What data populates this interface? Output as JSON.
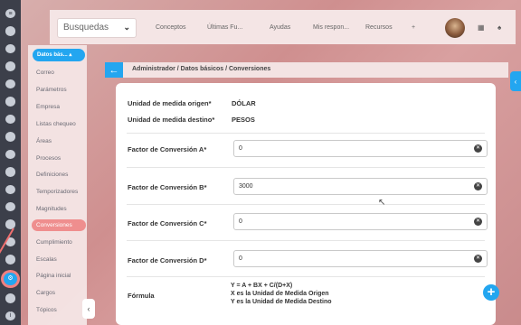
{
  "topbar": {
    "search_label": "Busquedas",
    "links": [
      "Conceptos",
      "Últimas Fu...",
      "Ayudas",
      "Mis respon...",
      "Recursos"
    ]
  },
  "sidebar": {
    "header": "Datos bás...",
    "items": [
      {
        "label": "Correo"
      },
      {
        "label": "Parámetros"
      },
      {
        "label": "Empresa"
      },
      {
        "label": "Listas chequeo"
      },
      {
        "label": "Áreas"
      },
      {
        "label": "Procesos"
      },
      {
        "label": "Definiciones"
      },
      {
        "label": "Temporizadores"
      },
      {
        "label": "Magnitudes"
      },
      {
        "label": "Conversiones",
        "highlighted": true
      },
      {
        "label": "Cumplimiento"
      },
      {
        "label": "Escalas"
      },
      {
        "label": "Página inicial"
      },
      {
        "label": "Cargos"
      },
      {
        "label": "Tópicos"
      }
    ]
  },
  "breadcrumb": "Administrador / Datos básicos / Conversiones",
  "form": {
    "origin_label": "Unidad de medida origen*",
    "origin_value": "DÓLAR",
    "dest_label": "Unidad de medida destino*",
    "dest_value": "PESOS",
    "factor_a_label": "Factor de Conversión A*",
    "factor_a_value": "0",
    "factor_b_label": "Factor de Conversión B*",
    "factor_b_value": "3000",
    "factor_c_label": "Factor de Conversión C*",
    "factor_c_value": "0",
    "factor_d_label": "Factor de Conversión D*",
    "factor_d_value": "0",
    "formula_label": "Fórmula",
    "formula_line1": "Y = A + BX + C/(D+X)",
    "formula_line2": "X es la Unidad de Medida Origen",
    "formula_line3": "Y es la Unidad de Medida Destino"
  },
  "colors": {
    "accent": "#23a6f0",
    "highlight": "#ef8e8e"
  },
  "icons": {
    "back": "arrow-left-icon",
    "clear": "clear-circle-icon",
    "add": "plus-circle-icon"
  }
}
